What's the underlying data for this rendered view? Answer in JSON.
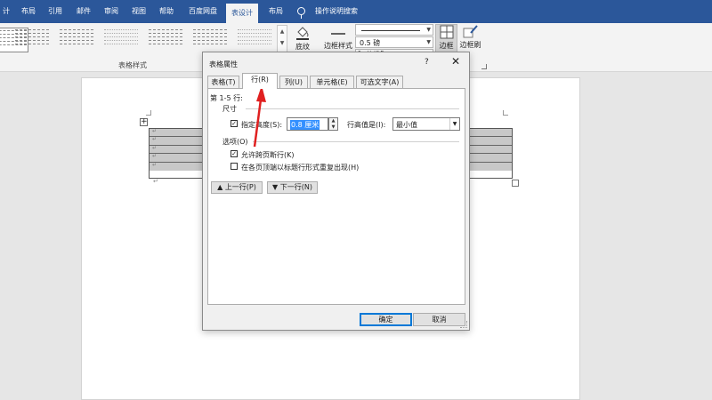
{
  "ribbon_tabs": [
    {
      "label": "计"
    },
    {
      "label": "布局"
    },
    {
      "label": "引用"
    },
    {
      "label": "邮件"
    },
    {
      "label": "审阅"
    },
    {
      "label": "视图"
    },
    {
      "label": "帮助"
    },
    {
      "label": "百度网盘"
    },
    {
      "label": "表设计"
    },
    {
      "label": "布局"
    }
  ],
  "search": {
    "label": "操作说明搜索"
  },
  "ribbon": {
    "table_styles_group": "表格样式",
    "shading": "底纹",
    "border_styles": "边框样式",
    "pen_weight": "0.5 磅",
    "pen_color": "笔颜色",
    "borders": "边框",
    "border_painter": "边框刷"
  },
  "dialog": {
    "title": "表格属性",
    "help": "?",
    "close": "✕",
    "tabs": [
      "表格(T)",
      "行(R)",
      "列(U)",
      "单元格(E)",
      "可选文字(A)"
    ],
    "rows_label": "第 1-5 行:",
    "size_label": "尺寸",
    "specify_height_label": "指定高度(S):",
    "height_value": "0.8 厘米",
    "row_height_is_label": "行高值是(I):",
    "row_height_rule": "最小值",
    "options_label": "选项(O)",
    "allow_break_label": "允许跨页断行(K)",
    "repeat_header_label": "在各页顶端以标题行形式重复出现(H)",
    "prev_row": "上一行(P)",
    "next_row": "下一行(N)",
    "ok": "确定",
    "cancel": "取消"
  },
  "colors": {
    "accent": "#2b579a",
    "arrow": "#e02020"
  }
}
